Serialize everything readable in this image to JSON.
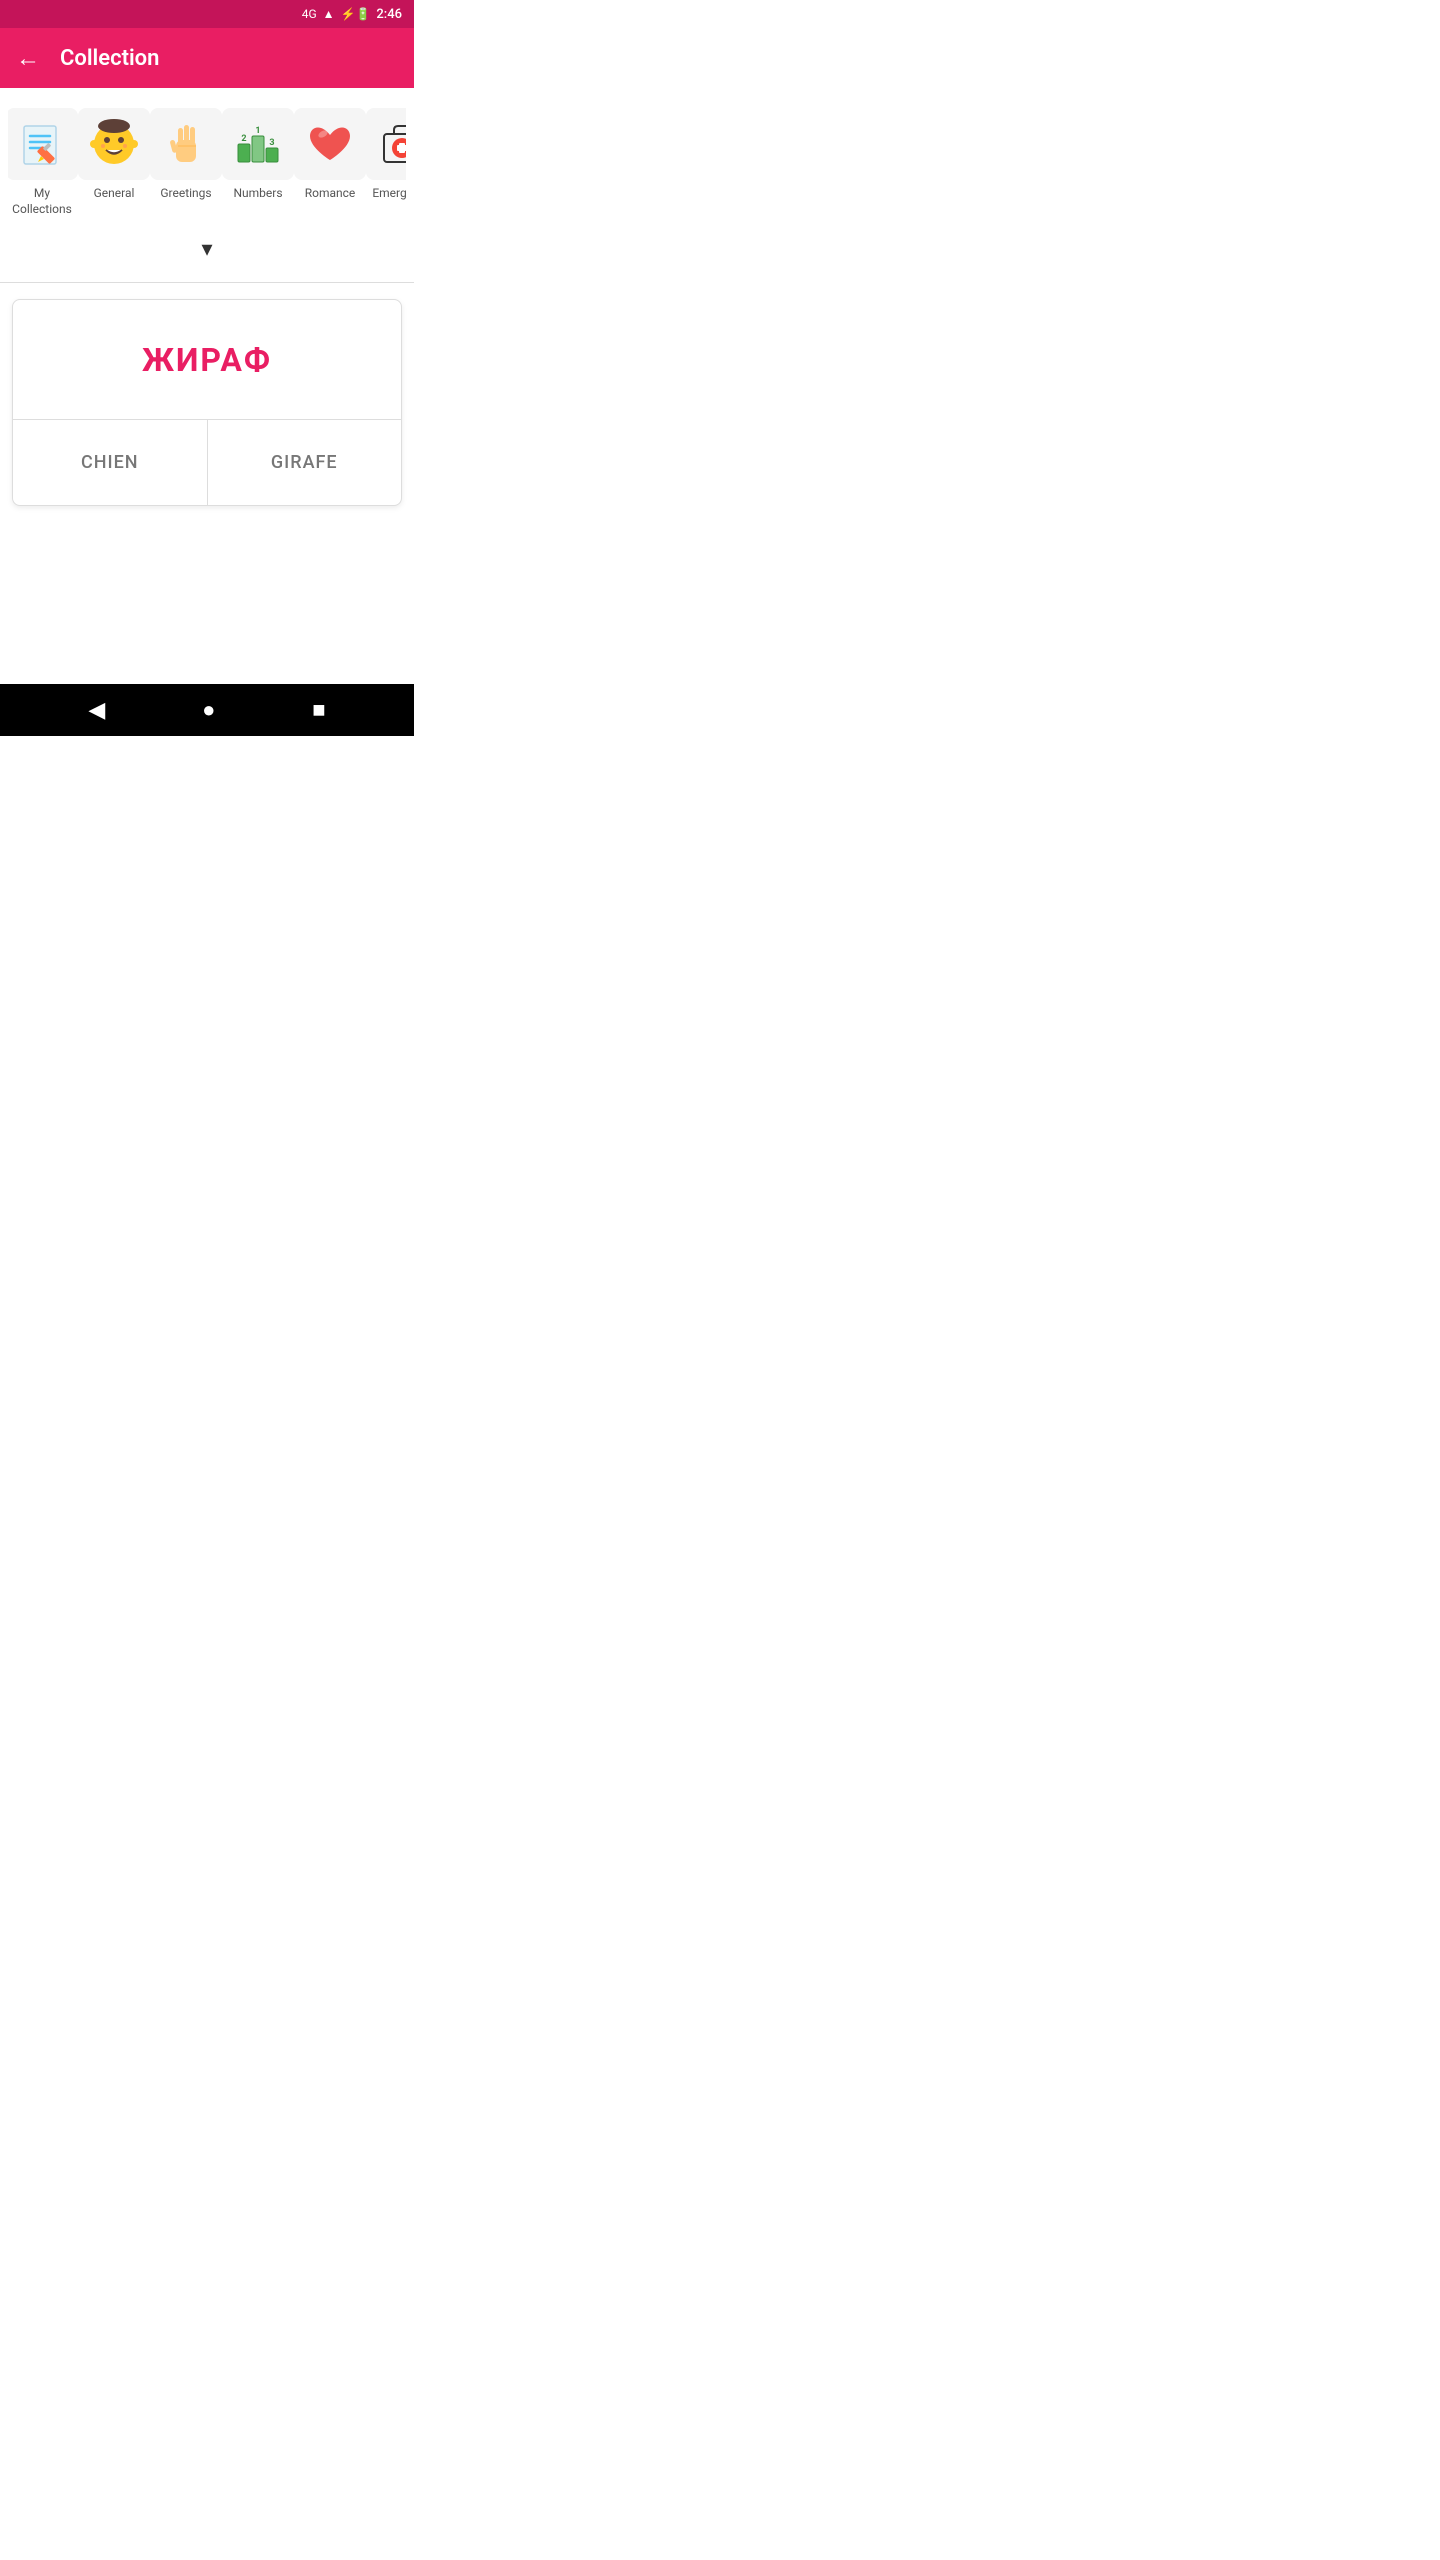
{
  "statusBar": {
    "network": "4G",
    "time": "2:46"
  },
  "appBar": {
    "backLabel": "←",
    "title": "Collection"
  },
  "categories": [
    {
      "id": "my-collections",
      "label": "My Collections",
      "iconType": "pencil-paper"
    },
    {
      "id": "general",
      "label": "General",
      "iconType": "face"
    },
    {
      "id": "greetings",
      "label": "Greetings",
      "iconType": "hand"
    },
    {
      "id": "numbers",
      "label": "Numbers",
      "iconType": "numbers"
    },
    {
      "id": "romance",
      "label": "Romance",
      "iconType": "heart"
    },
    {
      "id": "emergency",
      "label": "Emergency",
      "iconType": "medical"
    }
  ],
  "chevron": "▾",
  "flashcard": {
    "word": "ЖИРАФ",
    "option1": "CHIEN",
    "option2": "GIRAFE"
  },
  "bottomNav": {
    "back": "◀",
    "home": "●",
    "square": "■"
  }
}
